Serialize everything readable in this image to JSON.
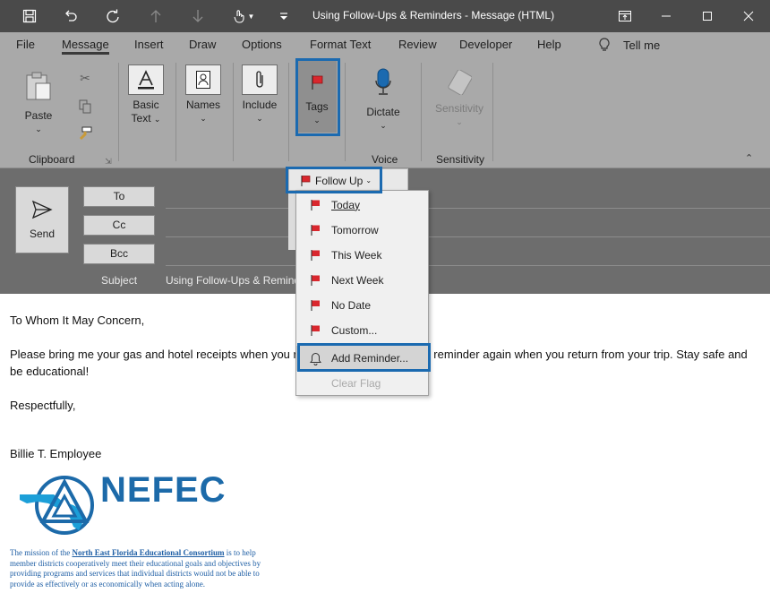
{
  "window": {
    "title": "Using Follow-Ups & Reminders  -  Message (HTML)",
    "quick_access": [
      "save-icon",
      "undo-icon",
      "redo-icon",
      "up-arrow-icon",
      "down-arrow-icon",
      "touch-mode-icon",
      "customize-icon"
    ],
    "controls": [
      "ribbon-display-icon",
      "minimize-icon",
      "maximize-icon",
      "close-icon"
    ]
  },
  "tabs": [
    {
      "label": "File"
    },
    {
      "label": "Message",
      "active": true
    },
    {
      "label": "Insert"
    },
    {
      "label": "Draw"
    },
    {
      "label": "Options"
    },
    {
      "label": "Format Text"
    },
    {
      "label": "Review"
    },
    {
      "label": "Developer"
    },
    {
      "label": "Help"
    },
    {
      "label": "Tell me"
    }
  ],
  "ribbon": {
    "paste": "Paste",
    "clipboard_group": "Clipboard",
    "basic_text_line1": "Basic",
    "basic_text_line2": "Text",
    "names": "Names",
    "include": "Include",
    "tags": "Tags",
    "dictate": "Dictate",
    "voice_group": "Voice",
    "sensitivity": "Sensitivity",
    "sensitivity_group": "Sensitivity"
  },
  "compose": {
    "send": "Send",
    "to": "To",
    "cc": "Cc",
    "bcc": "Bcc",
    "subject_label": "Subject",
    "subject_value": "Using Follow-Ups & Reminders"
  },
  "follow_up": {
    "label": "Follow Up",
    "items": [
      {
        "label": "Today",
        "icon": "flag-icon"
      },
      {
        "label": "Tomorrow",
        "icon": "flag-icon"
      },
      {
        "label": "This Week",
        "icon": "flag-icon"
      },
      {
        "label": "Next Week",
        "icon": "flag-icon"
      },
      {
        "label": "No Date",
        "icon": "flag-icon"
      },
      {
        "label": "Custom...",
        "icon": "flag-icon"
      },
      {
        "label": "Add Reminder...",
        "icon": "bell-icon"
      },
      {
        "label": "Clear Flag",
        "icon": "",
        "disabled": true
      }
    ]
  },
  "body": {
    "greeting": "To Whom It May Concern,",
    "paragraph": "Please bring me your gas and hotel receipts when you return, you will receive this reminder again when you return from your trip. Stay safe and be educational!",
    "closing": "Respectfully,",
    "signature": "Billie T. Employee",
    "logo_text": "NEFEC",
    "mission_prefix": "The mission of the ",
    "mission_link": "North East Florida Educational Consortium",
    "mission_rest": " is to help member districts cooperatively meet their educational goals and objectives by providing programs and services that individual districts would not be able to provide as effectively or as economically when acting alone."
  },
  "colors": {
    "highlight": "#1b6ab0",
    "flag": "#d9272e",
    "brand": "#1c6aa9"
  }
}
